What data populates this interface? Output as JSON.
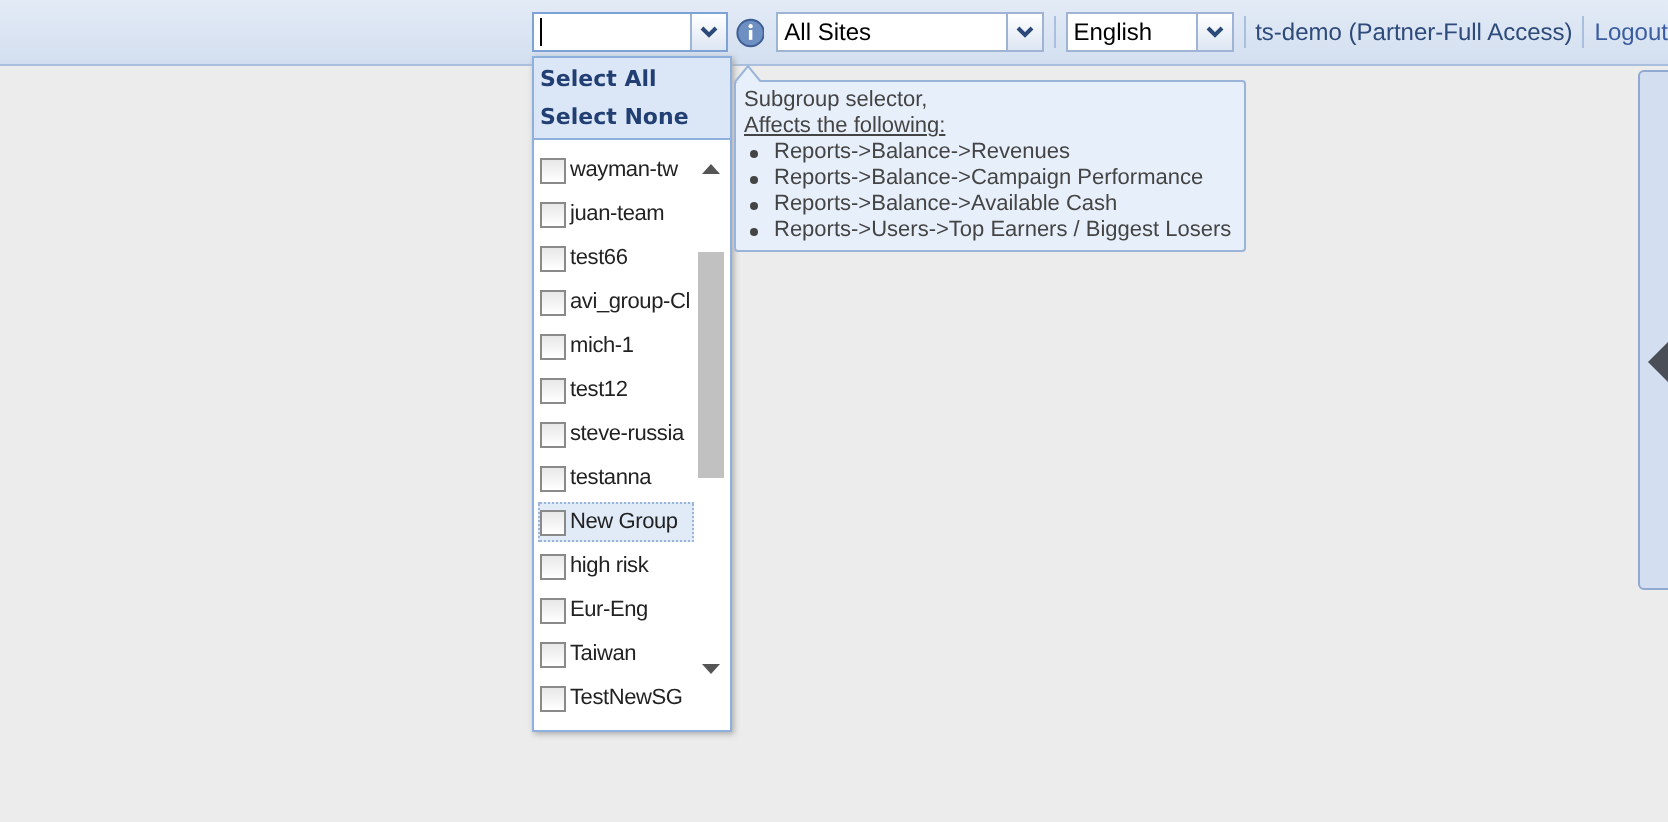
{
  "toolbar": {
    "sites_select": {
      "value": "All Sites"
    },
    "language_select": {
      "value": "English"
    },
    "user": "ts-demo (Partner-Full Access)",
    "logout": "Logout"
  },
  "subgroup_dropdown": {
    "actions": [
      "Select All",
      "Select None"
    ],
    "items": [
      {
        "label": "wayman-tw",
        "checked": false,
        "selected": false
      },
      {
        "label": "juan-team",
        "checked": false,
        "selected": false
      },
      {
        "label": "test66",
        "checked": false,
        "selected": false
      },
      {
        "label": "avi_group-Cl",
        "checked": false,
        "selected": false
      },
      {
        "label": "mich-1",
        "checked": false,
        "selected": false
      },
      {
        "label": "test12",
        "checked": false,
        "selected": false
      },
      {
        "label": "steve-russia",
        "checked": false,
        "selected": false
      },
      {
        "label": "testanna",
        "checked": false,
        "selected": false
      },
      {
        "label": "New Group",
        "checked": false,
        "selected": true
      },
      {
        "label": "high risk",
        "checked": false,
        "selected": false
      },
      {
        "label": "Eur-Eng",
        "checked": false,
        "selected": false
      },
      {
        "label": "Taiwan",
        "checked": false,
        "selected": false
      },
      {
        "label": "TestNewSG",
        "checked": false,
        "selected": false
      }
    ]
  },
  "tooltip": {
    "title": "Subgroup selector,",
    "subtitle": "Affects the following:",
    "bullets": [
      "Reports->Balance->Revenues",
      "Reports->Balance->Campaign Performance",
      "Reports->Balance->Available Cash",
      "Reports->Users->Top Earners / Biggest Losers"
    ]
  }
}
